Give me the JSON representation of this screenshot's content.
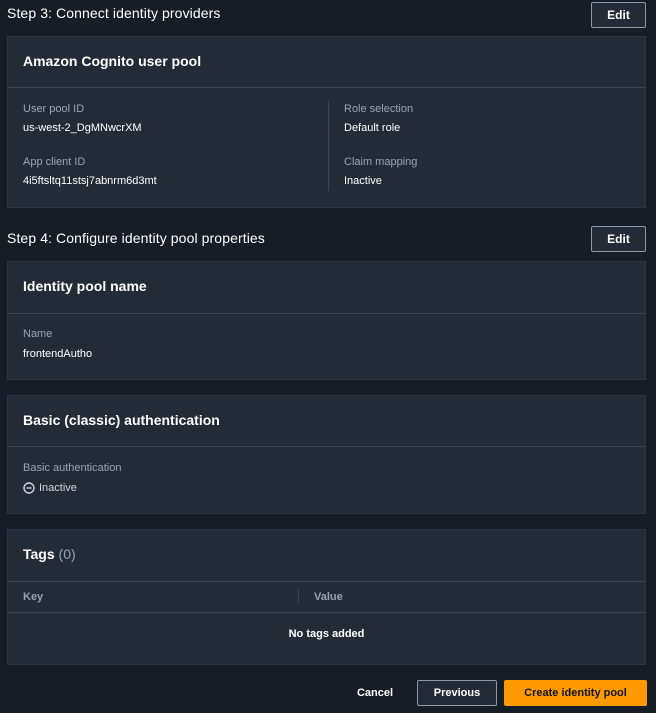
{
  "step3": {
    "title": "Step 3: Connect identity providers",
    "edit_label": "Edit",
    "card_title": "Amazon Cognito user pool",
    "user_pool_id_label": "User pool ID",
    "user_pool_id_value": "us-west-2_DgMNwcrXM",
    "app_client_id_label": "App client ID",
    "app_client_id_value": "4i5ftsltq11stsj7abnrm6d3mt",
    "role_selection_label": "Role selection",
    "role_selection_value": "Default role",
    "claim_mapping_label": "Claim mapping",
    "claim_mapping_value": "Inactive"
  },
  "step4": {
    "title": "Step 4: Configure identity pool properties",
    "edit_label": "Edit",
    "pool_name_card_title": "Identity pool name",
    "name_label": "Name",
    "name_value": "frontendAutho",
    "basic_auth_card_title": "Basic (classic) authentication",
    "basic_auth_label": "Basic authentication",
    "basic_auth_value": "Inactive",
    "basic_auth_icon": "minus-circle-icon"
  },
  "tags": {
    "title": "Tags",
    "count": "(0)",
    "columns": [
      "Key",
      "Value"
    ],
    "empty_text": "No tags added"
  },
  "footer": {
    "cancel_label": "Cancel",
    "previous_label": "Previous",
    "create_label": "Create identity pool"
  },
  "colors": {
    "background": "#161d26",
    "card": "#232b37",
    "primary_button": "#ff9900"
  }
}
